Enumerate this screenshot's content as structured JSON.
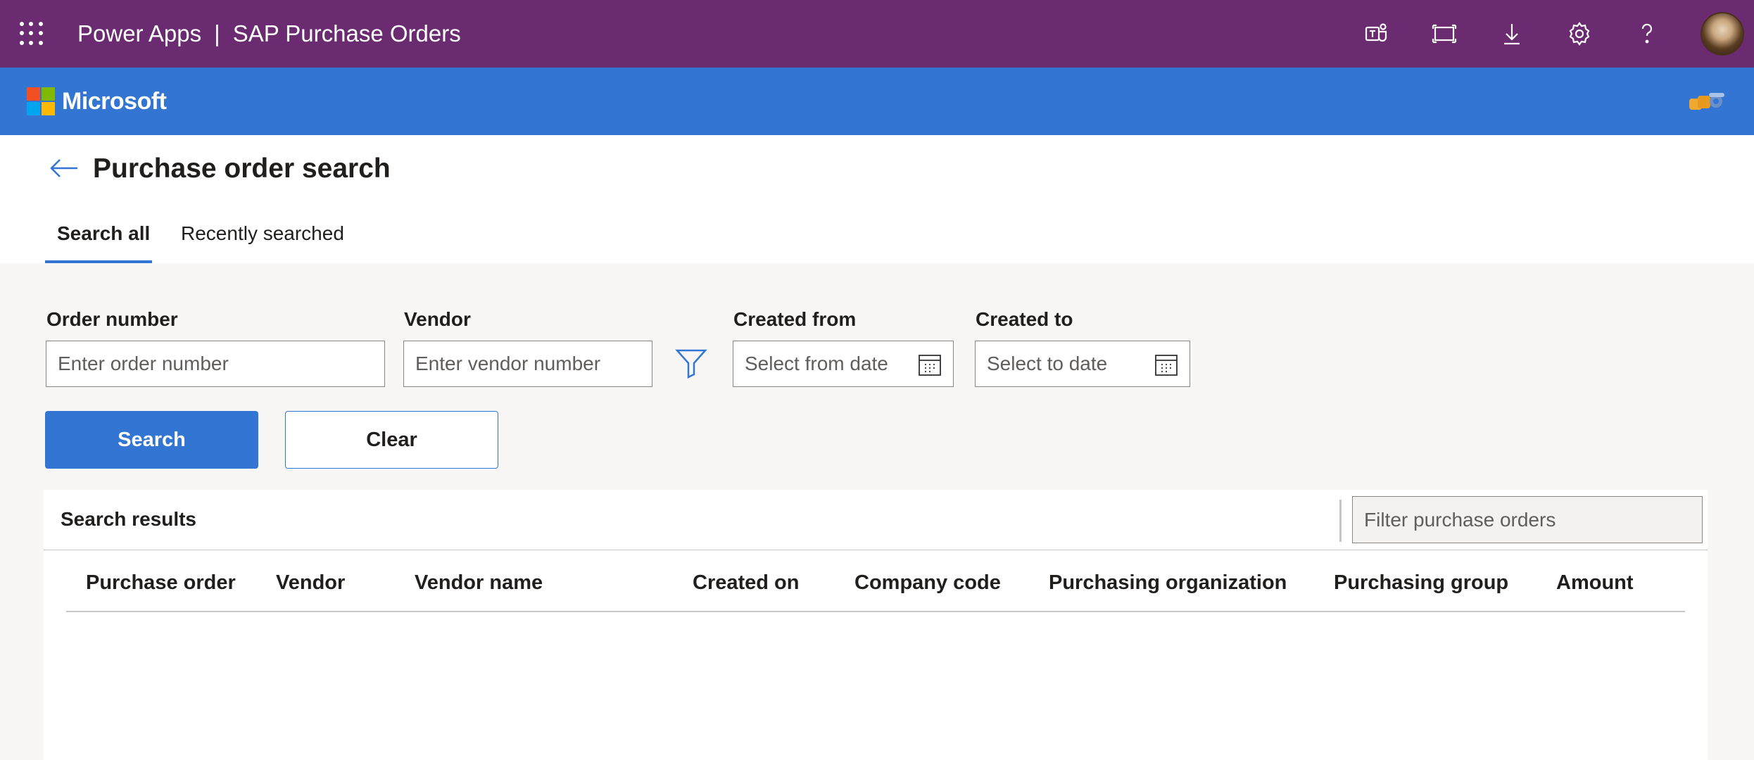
{
  "appbar": {
    "app_name": "Power Apps",
    "separator": "|",
    "app_title": "SAP Purchase Orders",
    "background": "#6b2b70",
    "icons": [
      "waffle-icon",
      "teams-icon",
      "fit-screen-icon",
      "download-icon",
      "settings-icon",
      "help-icon"
    ]
  },
  "brandbar": {
    "logo_text": "Microsoft",
    "background": "#3375d2"
  },
  "page": {
    "title": "Purchase order search"
  },
  "tabs": [
    {
      "label": "Search all",
      "active": true
    },
    {
      "label": "Recently searched",
      "active": false
    }
  ],
  "form": {
    "order_number": {
      "label": "Order number",
      "placeholder": "Enter order number",
      "value": ""
    },
    "vendor": {
      "label": "Vendor",
      "placeholder": "Enter vendor number",
      "value": ""
    },
    "created_from": {
      "label": "Created from",
      "placeholder": "Select from date"
    },
    "created_to": {
      "label": "Created to",
      "placeholder": "Select to date"
    },
    "search_label": "Search",
    "clear_label": "Clear"
  },
  "results": {
    "title": "Search results",
    "filter_placeholder": "Filter purchase orders",
    "columns": [
      "Purchase order",
      "Vendor",
      "Vendor name",
      "Created on",
      "Company code",
      "Purchasing organization",
      "Purchasing group",
      "Amount"
    ],
    "rows": []
  },
  "colors": {
    "accent": "#3375d2",
    "appbar": "#6b2b70"
  }
}
